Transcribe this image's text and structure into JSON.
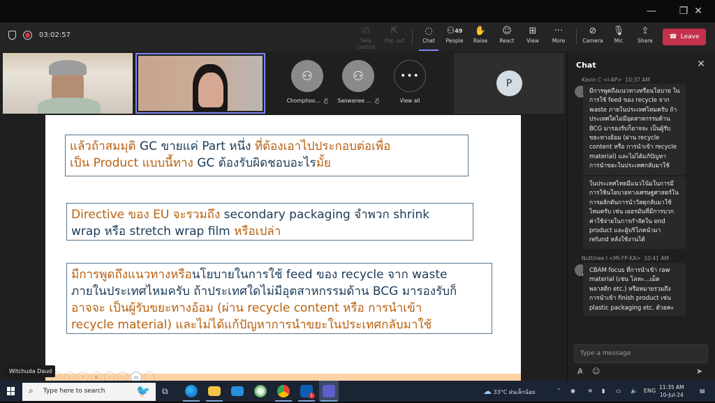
{
  "window": {
    "controls": {
      "minimize": "—",
      "maximize": "❐",
      "close": "✕"
    }
  },
  "toolbar": {
    "timer": "03:02:57",
    "buttons": [
      {
        "id": "take-control",
        "label": "Take control",
        "icon": "monitor-pointer-icon",
        "glyph": "⎚",
        "disabled": true
      },
      {
        "id": "pop-out",
        "label": "Pop out",
        "icon": "pop-out-icon",
        "glyph": "⇱",
        "disabled": true
      },
      {
        "id": "chat",
        "label": "Chat",
        "icon": "chat-icon",
        "glyph": "💬",
        "active": true
      },
      {
        "id": "people",
        "label": "People",
        "icon": "people-icon",
        "glyph": "👤",
        "count": "49"
      },
      {
        "id": "raise",
        "label": "Raise",
        "icon": "raise-hand-icon",
        "glyph": "✋"
      },
      {
        "id": "react",
        "label": "React",
        "icon": "smiley-icon",
        "glyph": "☺"
      },
      {
        "id": "view",
        "label": "View",
        "icon": "grid-view-icon",
        "glyph": "⊞"
      },
      {
        "id": "more",
        "label": "More",
        "icon": "more-icon",
        "glyph": "···"
      },
      {
        "id": "camera",
        "label": "Camera",
        "icon": "camera-off-icon",
        "glyph": "■"
      },
      {
        "id": "mic",
        "label": "Mic",
        "icon": "mic-off-icon",
        "glyph": "🎙"
      },
      {
        "id": "share",
        "label": "Share",
        "icon": "share-icon",
        "glyph": "⇪"
      }
    ],
    "leave_label": "Leave",
    "leave_color": "#c4314b",
    "accent_color": "#7f85f5"
  },
  "participants": {
    "avatars": [
      {
        "name": "Chomphoo...",
        "muted": true
      },
      {
        "name": "Saowanee ...",
        "muted": true
      }
    ],
    "view_all_label": "View all",
    "p_initial": "P"
  },
  "slide": {
    "boxes": [
      {
        "lines": [
          [
            {
              "t": "แล้วถ้าสมมุติ ",
              "c": "orange"
            },
            {
              "t": "GC ขายแค่ Part หนึ่ง ",
              "c": "navy"
            },
            {
              "t": "ที่ต้องเอาไปประกอบต่อเพื่อ",
              "c": "orange"
            }
          ],
          [
            {
              "t": "เป็น Product แบบนี้ทาง ",
              "c": "orange"
            },
            {
              "t": "GC ต้องรับผิดชอบอะไร",
              "c": "navy"
            },
            {
              "t": "มั้ย",
              "c": "orange"
            }
          ]
        ]
      },
      {
        "lines": [
          [
            {
              "t": "Directive ของ EU จะรวมถึง ",
              "c": "orange"
            },
            {
              "t": "secondary packaging จำพวก shrink",
              "c": "navy"
            }
          ],
          [
            {
              "t": "wrap หรือ stretch wrap film ",
              "c": "navy"
            },
            {
              "t": "หรือเปล่า",
              "c": "orange"
            }
          ]
        ]
      },
      {
        "lines": [
          [
            {
              "t": "มีการพูดถึงแนวทางหรือ",
              "c": "orange"
            },
            {
              "t": "นโยบายในการใช้ feed ของ recycle จาก waste",
              "c": "navy"
            }
          ],
          [
            {
              "t": "ภายในประเทศไหมครับ ถ้าประเทศใดไม่มีอุตสาหกรรมด้าน BCG มารองรับก็",
              "c": "navy"
            }
          ],
          [
            {
              "t": "อาจจะ เป็นผู้รับขยะทางอ้อม (ผ่าน recycle content หรือ การนำเข้า",
              "c": "orange"
            }
          ],
          [
            {
              "t": "recycle material) และไม่ได้แก้ปัญหาการนำขยะในประเทศกลับมาใช้",
              "c": "orange"
            }
          ]
        ]
      }
    ],
    "presenter_name": "Witchuda Daud",
    "colors": {
      "orange": "#b8600f",
      "navy": "#1b3a57"
    }
  },
  "chat": {
    "title": "Chat",
    "messages": [
      {
        "author": "Kavin C <I-AP>",
        "time": "10:37 AM",
        "bubbles": [
          "มีการพูดถึงแนวทางหรือนโยบาย ในการใช้ feed ของ recycle จาก waste ภายในประเทศไหมครับ ถ้าประเทศใดไม่มีอุตสาหกรรมด้าน BCG มารองรับก็อาจจะ เป็นผู้รับขยะทางอ้อม (ผ่าน recycle content หรือ การนำเข้า recycle material) และไม่ได้แก้ปัญหาการนำขยะในประเทศกลับมาใช้",
          "ในประเทศไทยมีแนวโน้มในการมีการใช้นโยบายทางเศรษฐศาสตร์ในการผลักดันการนำวัสดุกลับมาใช้ไหมครับ เช่น เยอรมันที่มีการบวกค่าใช้จ่ายในการกำจัดใน end product และผู้บริโภคนำมา refund หลังใช้งานได้"
        ]
      },
      {
        "author": "Nuttinee I <MI-FP-KA>",
        "time": "10:41 AM",
        "bubbles": [
          "CBAM focus ที่การนำเข้า raw material (เช่น โลหะ...เม็ดพลาสติก etc.) หรือหมายรวมถึงการนำเข้า finish product เช่น plastic packaging etc. ด้วยคะ"
        ]
      }
    ],
    "compose_placeholder": "Type a message"
  },
  "taskbar": {
    "search_placeholder": "Type here to search",
    "apps": [
      "task-view",
      "edge",
      "file-explorer",
      "mail",
      "browser-green",
      "chrome",
      "outlook-badge",
      "teams"
    ],
    "outlook_badge": "1",
    "weather_badge": "1",
    "weather": "33°C ฝนเล็กน้อย",
    "language": "ENG",
    "time": "11:35 AM",
    "date": "10-Jul-24"
  }
}
